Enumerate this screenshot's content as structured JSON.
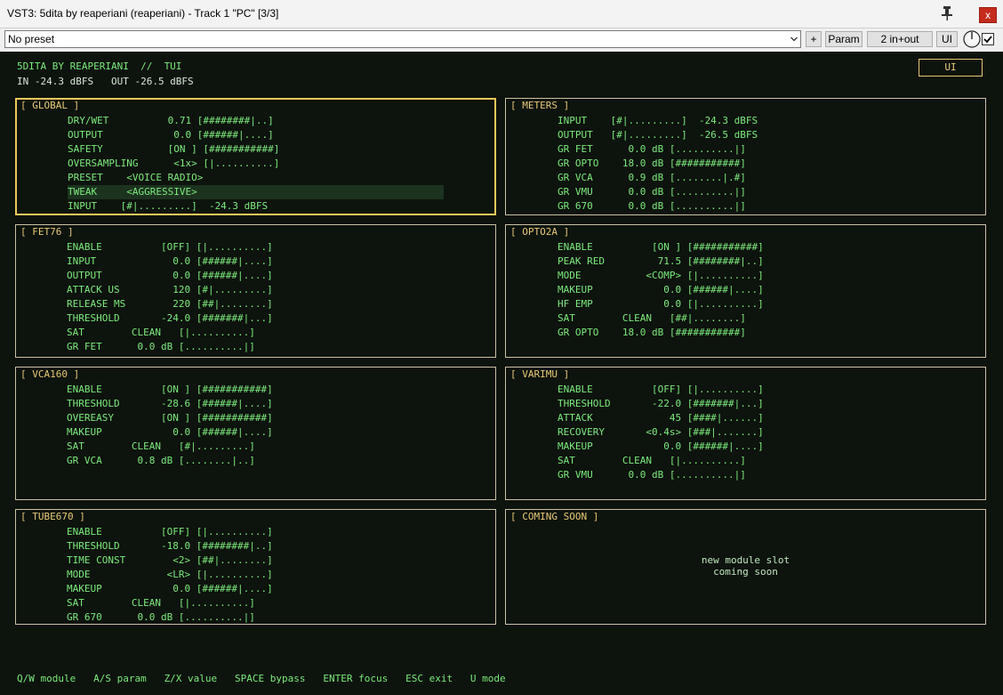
{
  "window": {
    "title": "VST3: 5dita by reaperiani (reaperiani) - Track 1 \"PC\" [3/3]",
    "close_label": "x"
  },
  "toolbar": {
    "preset_value": "No preset",
    "plus_label": "+",
    "param_label": "Param",
    "io_label": "2 in+out",
    "ui_label": "UI"
  },
  "header": {
    "title": "5DITA BY REAPERIANI  //  TUI",
    "levels": "IN -24.3 dBFS   OUT -26.5 dBFS",
    "ui_button": "UI"
  },
  "panels": {
    "global": {
      "title": "[ GLOBAL ]",
      "rows": [
        "DRY/WET          0.71 [########|..]",
        "OUTPUT            0.0 [######|....]",
        "SAFETY           [ON ] [###########]",
        "OVERSAMPLING      <1x> [|..........]",
        "PRESET    <VOICE RADIO>",
        "TWEAK     <AGGRESSIVE>",
        "INPUT    [#|.........]  -24.3 dBFS"
      ]
    },
    "meters": {
      "title": "[ METERS ]",
      "rows": [
        "INPUT    [#|.........]  -24.3 dBFS",
        "OUTPUT   [#|.........]  -26.5 dBFS",
        "GR FET      0.0 dB [..........|]",
        "GR OPTO    18.0 dB [###########]",
        "GR VCA      0.9 dB [........|.#]",
        "GR VMU      0.0 dB [..........|]",
        "GR 670      0.0 dB [..........|]"
      ]
    },
    "fet76": {
      "title": "[ FET76 ]",
      "rows": [
        "ENABLE          [OFF] [|..........]",
        "INPUT             0.0 [######|....]",
        "OUTPUT            0.0 [######|....]",
        "ATTACK US         120 [#|.........]",
        "RELEASE MS        220 [##|........]",
        "THRESHOLD       -24.0 [#######|...]",
        "SAT        CLEAN   [|..........]",
        "GR FET      0.0 dB [..........|]"
      ]
    },
    "opto2a": {
      "title": "[ OPTO2A ]",
      "rows": [
        "ENABLE          [ON ] [###########]",
        "PEAK RED         71.5 [########|..]",
        "MODE           <COMP> [|..........]",
        "MAKEUP            0.0 [######|....]",
        "HF EMP            0.0 [|..........]",
        "SAT        CLEAN   [##|........]",
        "GR OPTO    18.0 dB [###########]"
      ]
    },
    "vca160": {
      "title": "[ VCA160 ]",
      "rows": [
        "ENABLE          [ON ] [###########]",
        "THRESHOLD       -28.6 [######|....]",
        "OVEREASY        [ON ] [###########]",
        "MAKEUP            0.0 [######|....]",
        "SAT        CLEAN   [#|.........]",
        "GR VCA      0.8 dB [........|..]"
      ]
    },
    "varimu": {
      "title": "[ VARIMU ]",
      "rows": [
        "ENABLE          [OFF] [|..........]",
        "THRESHOLD       -22.0 [#######|...]",
        "ATTACK             45 [####|......]",
        "RECOVERY       <0.4s> [###|.......]",
        "MAKEUP            0.0 [######|....]",
        "SAT        CLEAN   [|..........]",
        "GR VMU      0.0 dB [..........|]"
      ]
    },
    "tube670": {
      "title": "[ TUBE670 ]",
      "rows": [
        "ENABLE          [OFF] [|..........]",
        "THRESHOLD       -18.0 [########|..]",
        "TIME CONST        <2> [##|........]",
        "MODE             <LR> [|..........]",
        "MAKEUP            0.0 [######|....]",
        "SAT        CLEAN   [|..........]",
        "GR 670      0.0 dB [..........|]"
      ]
    },
    "coming_soon": {
      "title": "[ COMING SOON ]",
      "message": "new module slot\ncoming soon"
    }
  },
  "footer": {
    "help": "Q/W module   A/S param   Z/X value   SPACE bypass   ENTER focus   ESC exit   U mode"
  },
  "colors": {
    "background": "#0d130d",
    "text": "#7cea7c",
    "header": "#e6c878",
    "active_border": "#f0c95a",
    "highlight_row": "#1c331f"
  }
}
